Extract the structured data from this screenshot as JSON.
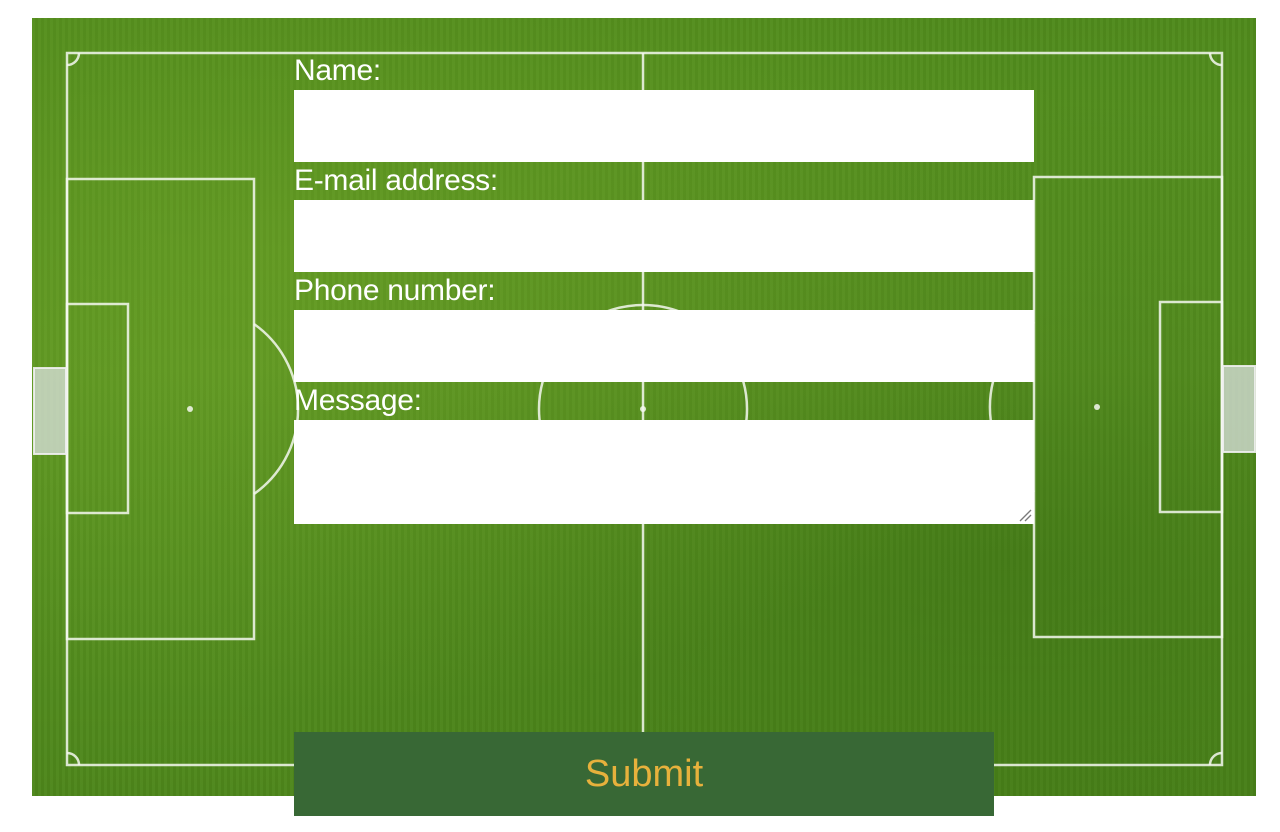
{
  "form": {
    "name_label": "Name:",
    "name_value": "",
    "email_label": "E-mail address:",
    "email_value": "",
    "phone_label": "Phone number:",
    "phone_value": "",
    "message_label": "Message:",
    "message_value": "",
    "submit_label": "Submit"
  },
  "colors": {
    "grass": "#5b9522",
    "field_lines": "#f5f8f0",
    "input_background": "#ffffff",
    "label_text": "#ffffff",
    "submit_background": "#386835",
    "submit_text": "#e7b13c"
  },
  "icons": {
    "background": "soccer-pitch-image",
    "textarea_corner": "resize-handle-icon"
  }
}
